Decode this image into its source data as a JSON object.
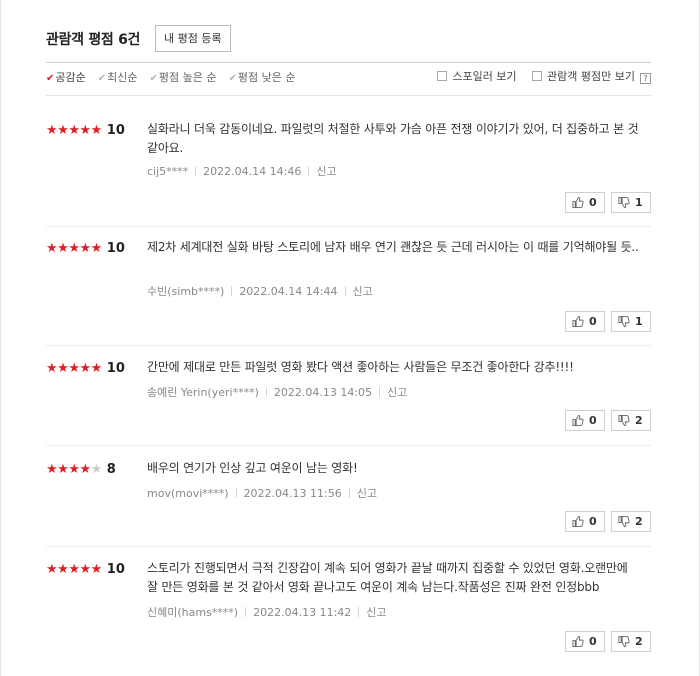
{
  "header": {
    "title": "관람객 평점",
    "count": "6건",
    "write_button": "내 평점 등록"
  },
  "sorts": [
    {
      "label": "공감순",
      "active": true
    },
    {
      "label": "최신순",
      "active": false
    },
    {
      "label": "평점 높은 순",
      "active": false
    },
    {
      "label": "평점 낮은 순",
      "active": false
    }
  ],
  "filters": {
    "spoiler": "스포일러 보기",
    "audience_only": "관람객 평점만 보기",
    "help": "?"
  },
  "labels": {
    "report": "신고"
  },
  "reviews": [
    {
      "stars": 5,
      "score": "10",
      "text": "실화라니 더욱 감동이네요. 파일럿의 처절한 사투와 가슴 아픈 전쟁 이야기가 있어, 더 집중하고 본 것 같아요.",
      "user": "cij5****",
      "date": "2022.04.14 14:46",
      "likes": "0",
      "dislikes": "1"
    },
    {
      "stars": 5,
      "score": "10",
      "text": "제2차 세계대전 실화 바탕 스토리에 남자 배우 연기 괜찮은 듯 근데 러시아는 이 때를 기억해야될 듯..",
      "user": "수빈(simb****)",
      "date": "2022.04.14 14:44",
      "likes": "0",
      "dislikes": "1"
    },
    {
      "stars": 5,
      "score": "10",
      "text": "간만에 제대로 만든 파일럿 영화 봤다 액션 좋아하는 사람들은 무조건 좋아한다 강추!!!!",
      "user": "송예린 Yerin(yeri****)",
      "date": "2022.04.13 14:05",
      "likes": "0",
      "dislikes": "2"
    },
    {
      "stars": 4,
      "score": "8",
      "text": "배우의 연기가 인상 깊고 여운이 남는 영화!",
      "user": "mov(movi****)",
      "date": "2022.04.13 11:56",
      "likes": "0",
      "dislikes": "2"
    },
    {
      "stars": 5,
      "score": "10",
      "text": "스토리가 진행되면서 극적 긴장감이 계속 되어 영화가 끝날 때까지 집중할 수 있었던 영화.오랜만에 잘 만든 영화를 본 것 같아서 영화 끝나고도 여운이 계속 남는다.작품성은 진짜 완전 인정bbb",
      "user": "신혜미(hams****)",
      "date": "2022.04.13 11:42",
      "likes": "0",
      "dislikes": "2"
    }
  ]
}
